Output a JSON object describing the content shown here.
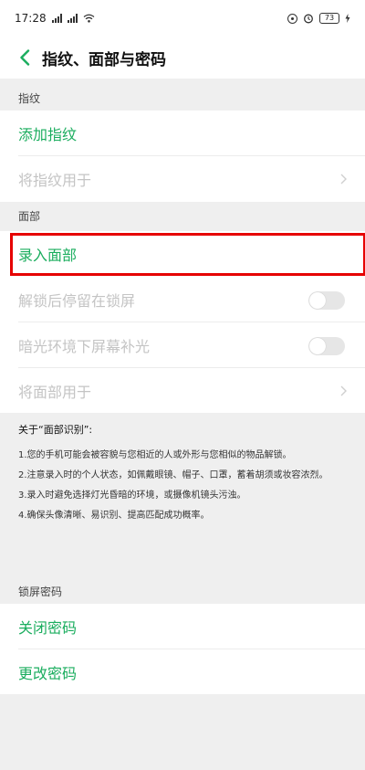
{
  "status_bar": {
    "time": "17:28",
    "battery": "73"
  },
  "header": {
    "title": "指纹、面部与密码"
  },
  "fingerprint": {
    "section_label": "指纹",
    "add_label": "添加指纹",
    "use_label": "将指纹用于"
  },
  "face": {
    "section_label": "面部",
    "enroll_label": "录入面部",
    "stay_on_lock_label": "解锁后停留在锁屏",
    "dim_light_label": "暗光环境下屏幕补光",
    "use_label": "将面部用于"
  },
  "about": {
    "title": "关于“面部识别”:",
    "items": [
      "1.您的手机可能会被容貌与您相近的人或外形与您相似的物品解锁。",
      "2.注意录入时的个人状态，如佩戴眼镜、帽子、口罩，蓄着胡须或妆容浓烈。",
      "3.录入时避免选择灯光昏暗的环境，或摄像机镜头污浊。",
      "4.确保头像清晰、易识别、提高匹配成功概率。"
    ]
  },
  "lock_password": {
    "section_label": "锁屏密码",
    "close_label": "关闭密码",
    "change_label": "更改密码"
  },
  "colors": {
    "accent": "#1aad5e",
    "disabled": "#c4c4c4",
    "highlight": "#e60000"
  }
}
